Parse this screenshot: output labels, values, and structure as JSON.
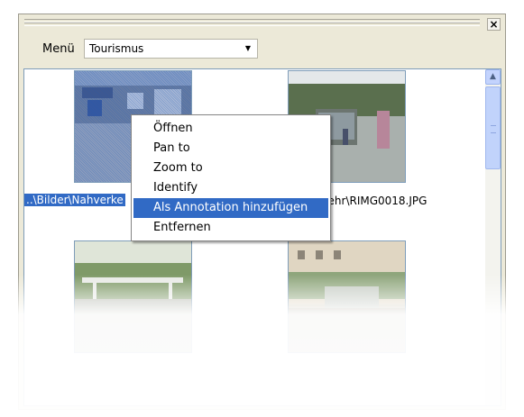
{
  "window": {
    "close_glyph": "×"
  },
  "toolbar": {
    "menu_label": "Menü",
    "layer_select": {
      "value": "Tourismus",
      "arrow_glyph": "▼"
    }
  },
  "thumbnails": [
    {
      "caption": "..\\Bilder\\Nahverke",
      "selected": true
    },
    {
      "caption": "kehr\\RIMG0018.JPG",
      "selected": false
    },
    {
      "caption": "",
      "selected": false
    },
    {
      "caption": "",
      "selected": false
    }
  ],
  "context_menu": {
    "items": [
      {
        "label": "Öffnen",
        "highlighted": false
      },
      {
        "label": "Pan to",
        "highlighted": false
      },
      {
        "label": "Zoom to",
        "highlighted": false
      },
      {
        "label": "Identify",
        "highlighted": false
      },
      {
        "label": "Als Annotation hinzufügen",
        "highlighted": true
      },
      {
        "label": "Entfernen",
        "highlighted": false
      }
    ]
  },
  "scrollbar": {
    "up_glyph": "▲"
  },
  "colors": {
    "selection": "#316ac5",
    "panel": "#ece9d8",
    "border": "#7f9db9"
  }
}
